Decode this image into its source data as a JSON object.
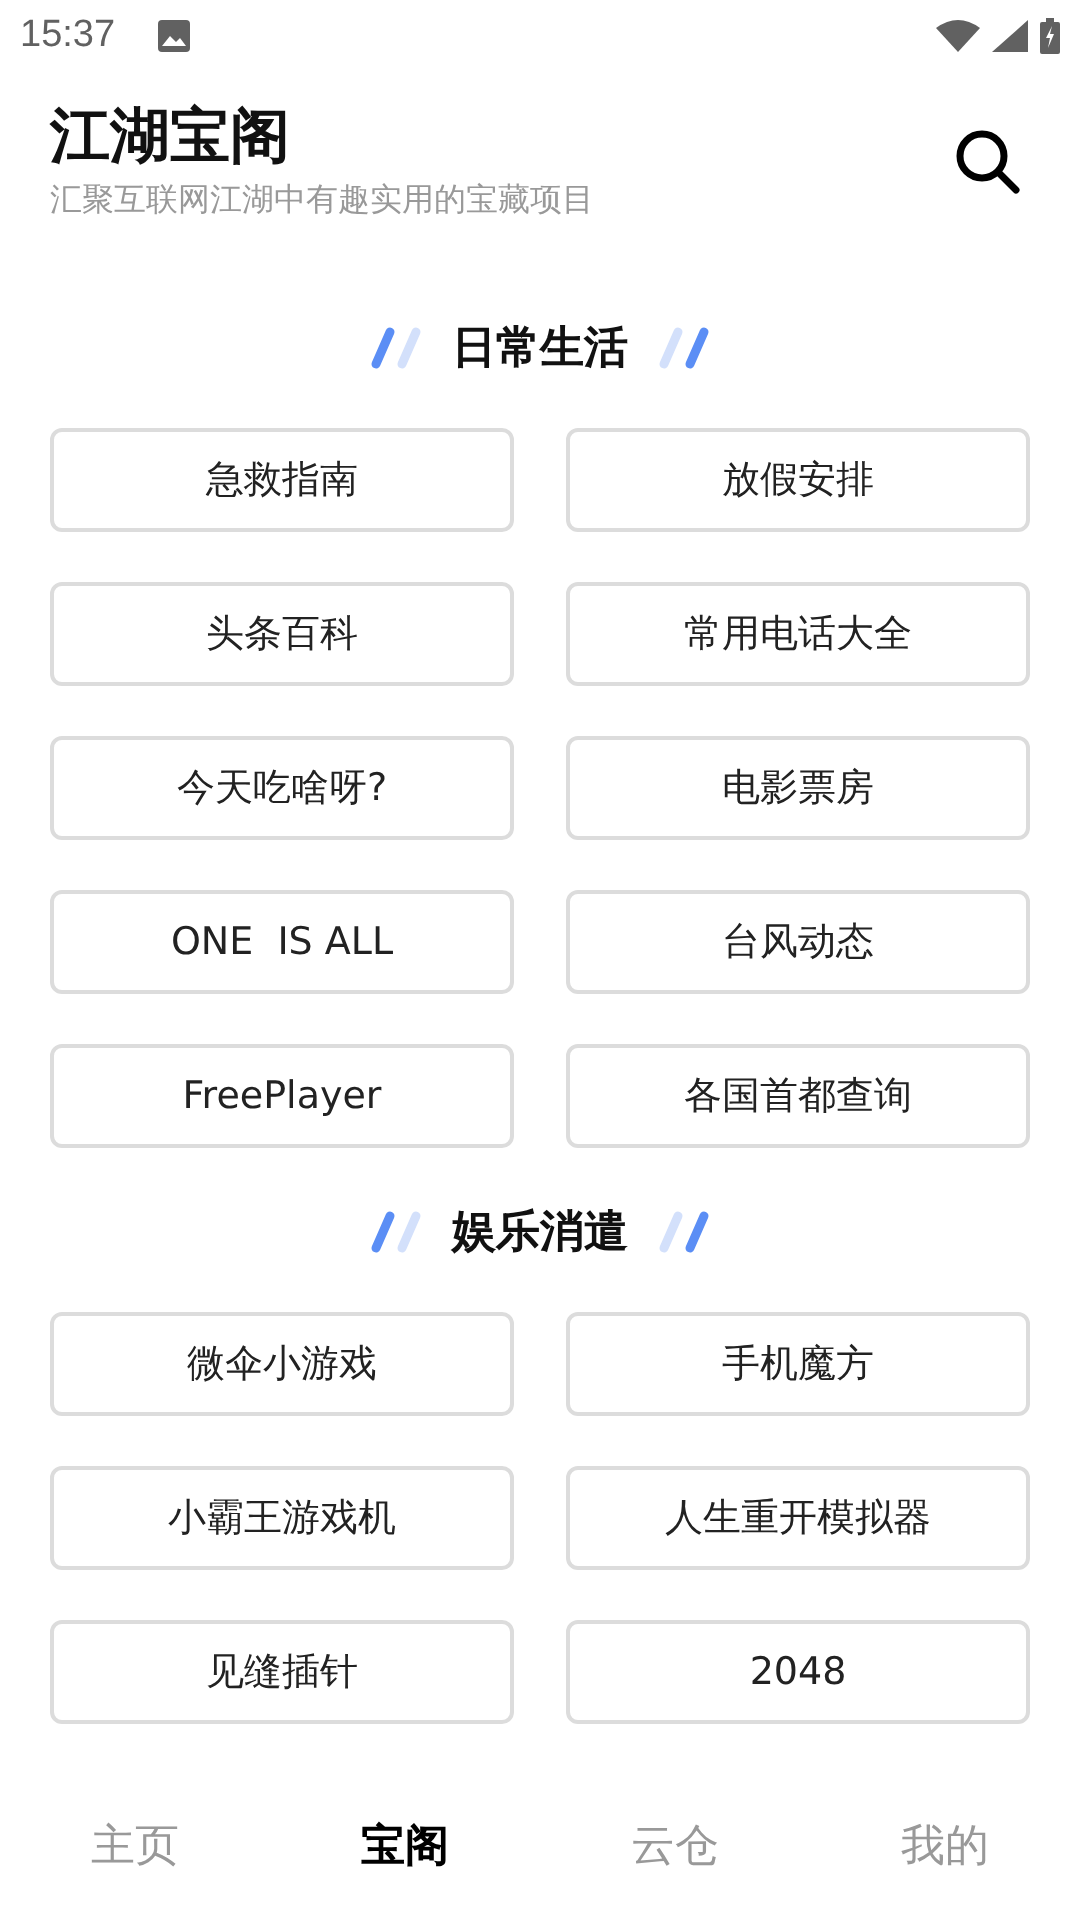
{
  "status_bar": {
    "time": "15:37"
  },
  "header": {
    "title": "江湖宝阁",
    "subtitle": "汇聚互联网江湖中有趣实用的宝藏项目"
  },
  "sections": [
    {
      "title": "日常生活",
      "items": [
        "急救指南",
        "放假安排",
        "头条百科",
        "常用电话大全",
        "今天吃啥呀?",
        "电影票房",
        "ONE  IS ALL",
        "台风动态",
        "FreePlayer",
        "各国首都查询"
      ]
    },
    {
      "title": "娱乐消遣",
      "items": [
        "微伞小游戏",
        "手机魔方",
        "小霸王游戏机",
        "人生重开模拟器",
        "见缝插针",
        "2048"
      ]
    }
  ],
  "bottom_nav": [
    {
      "label": "主页",
      "selected": false
    },
    {
      "label": "宝阁",
      "selected": true
    },
    {
      "label": "云仓",
      "selected": false
    },
    {
      "label": "我的",
      "selected": false
    }
  ]
}
